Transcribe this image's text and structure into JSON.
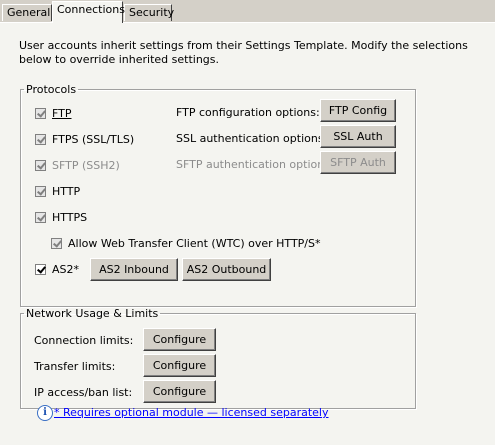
{
  "tabs": [
    {
      "label": "General"
    },
    {
      "label": "Connections"
    },
    {
      "label": "Security"
    }
  ],
  "description": "User accounts inherit settings from their Settings Template. Modify the selections below to override inherited settings.",
  "protocols": {
    "legend": "Protocols",
    "ftp": {
      "label": "FTP",
      "checked": true,
      "enabled": false
    },
    "ftps": {
      "label": "FTPS (SSL/TLS)",
      "checked": true,
      "enabled": false
    },
    "sftp": {
      "label": "SFTP (SSH2)",
      "checked": true,
      "enabled": false
    },
    "http": {
      "label": "HTTP",
      "checked": true,
      "enabled": false
    },
    "https": {
      "label": "HTTPS",
      "checked": true,
      "enabled": false
    },
    "wtc": {
      "label": "Allow Web Transfer Client (WTC) over HTTP/S*",
      "checked": true,
      "enabled": false
    },
    "as2": {
      "label": "AS2*",
      "checked": true,
      "enabled": true
    },
    "ftp_options_label": "FTP configuration options:",
    "ftp_config_button": "FTP Config",
    "ssl_options_label": "SSL authentication options:",
    "ssl_auth_button": "SSL Auth",
    "sftp_options_label": "SFTP authentication options:",
    "sftp_auth_button": "SFTP Auth",
    "as2_inbound_button": "AS2 Inbound",
    "as2_outbound_button": "AS2 Outbound"
  },
  "network": {
    "legend": "Network Usage & Limits",
    "connection_label": "Connection limits:",
    "transfer_label": "Transfer limits:",
    "ip_label": "IP access/ban list:",
    "configure_button": "Configure"
  },
  "footer": {
    "link": "* Requires optional module — licensed separately"
  }
}
